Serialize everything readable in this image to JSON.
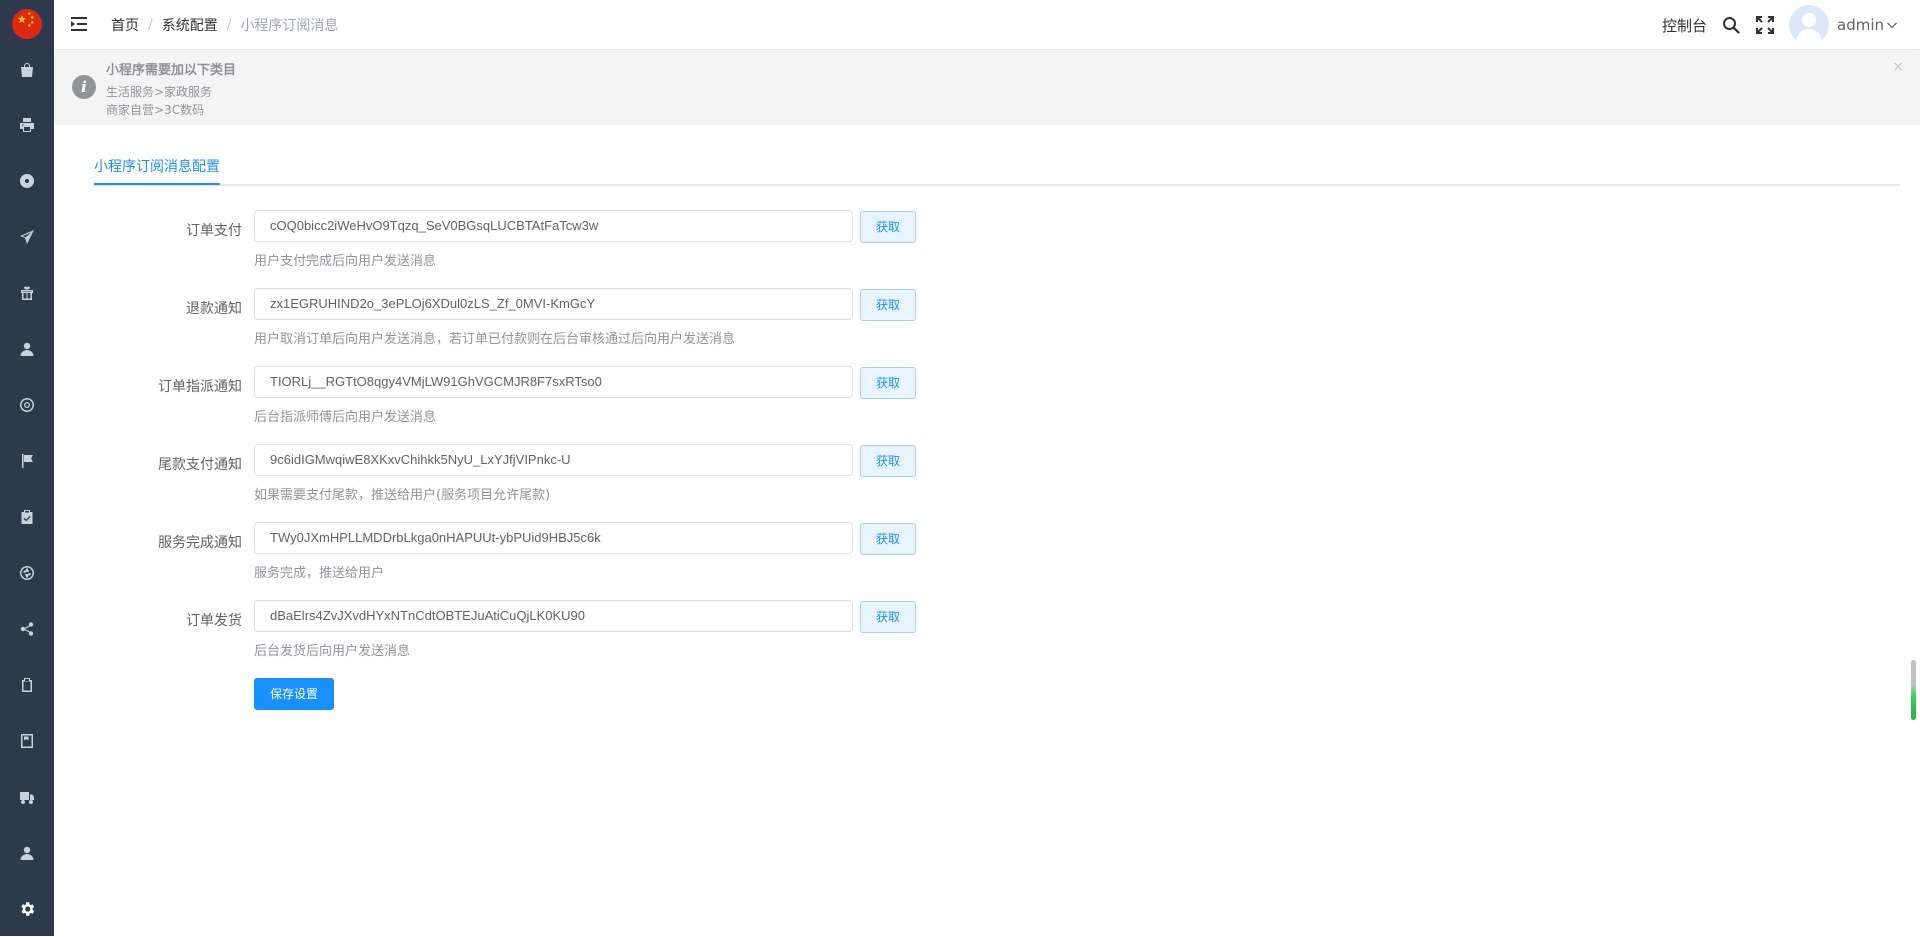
{
  "sidebar": {
    "items": [
      {
        "icon": "bag-icon"
      },
      {
        "icon": "printer-icon"
      },
      {
        "icon": "disc-icon"
      },
      {
        "icon": "send-icon"
      },
      {
        "icon": "gift-icon"
      },
      {
        "icon": "user-icon"
      },
      {
        "icon": "lifebuoy-icon"
      },
      {
        "icon": "flag-icon"
      },
      {
        "icon": "clipboard-check-icon"
      },
      {
        "icon": "aperture-icon"
      },
      {
        "icon": "share-icon"
      },
      {
        "icon": "copy-icon"
      },
      {
        "icon": "book-icon"
      },
      {
        "icon": "truck-icon"
      },
      {
        "icon": "user-icon"
      },
      {
        "icon": "gear-icon"
      }
    ]
  },
  "header": {
    "breadcrumb": [
      "首页",
      "系统配置",
      "小程序订阅消息"
    ],
    "breadcrumb_sep": "/",
    "console_label": "控制台",
    "username": "admin"
  },
  "alert": {
    "title": "小程序需要加以下类目",
    "lines": [
      "生活服务>家政服务",
      "商家自营>3C数码"
    ],
    "close": "×"
  },
  "tabs": {
    "active": "小程序订阅消息配置"
  },
  "form": {
    "fetch_label": "获取",
    "rows": [
      {
        "label": "订单支付",
        "value": "cOQ0bicc2iWeHvO9Tqzq_SeV0BGsqLUCBTAtFaTcw3w",
        "hint": "用户支付完成后向用户发送消息"
      },
      {
        "label": "退款通知",
        "value": "zx1EGRUHIND2o_3ePLOj6XDul0zLS_Zf_0MVI-KmGcY",
        "hint": "用户取消订单后向用户发送消息，若订单已付款则在后台审核通过后向用户发送消息"
      },
      {
        "label": "订单指派通知",
        "value": "TIORLj__RGTtO8qgy4VMjLW91GhVGCMJR8F7sxRTso0",
        "hint": "后台指派师傅后向用户发送消息"
      },
      {
        "label": "尾款支付通知",
        "value": "9c6idIGMwqiwE8XKxvChihkk5NyU_LxYJfjVIPnkc-U",
        "hint": "如果需要支付尾款，推送给用户(服务项目允许尾款)"
      },
      {
        "label": "服务完成通知",
        "value": "TWy0JXmHPLLMDDrbLkga0nHAPUUt-ybPUid9HBJ5c6k",
        "hint": "服务完成，推送给用户"
      },
      {
        "label": "订单发货",
        "value": "dBaElrs4ZvJXvdHYxNTnCdtOBTEJuAtiCuQjLK0KU90",
        "hint": "后台发货后向用户发送消息"
      }
    ],
    "save_label": "保存设置"
  },
  "colors": {
    "sidebar_bg": "#2d3a4b",
    "primary": "#1890ff",
    "alert_bg": "#f4f4f5"
  }
}
